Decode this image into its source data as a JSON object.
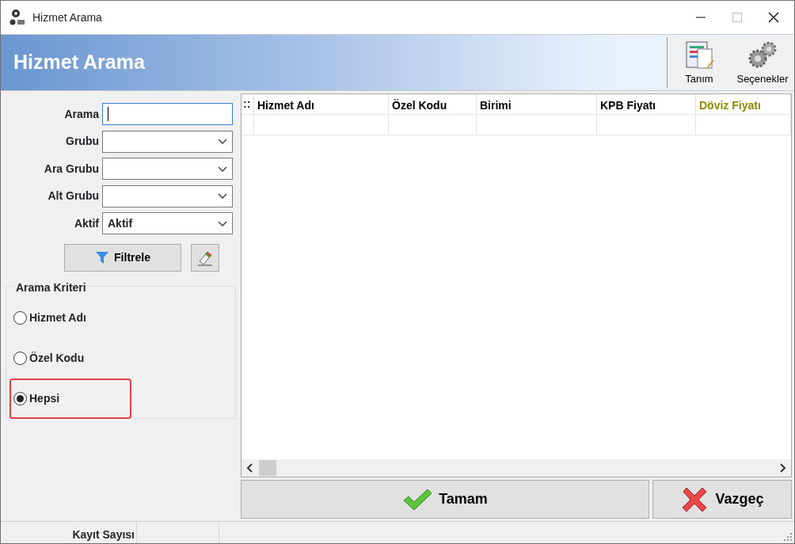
{
  "window": {
    "title": "Hizmet Arama"
  },
  "header": {
    "title": "Hizmet Arama",
    "tools": [
      {
        "label": "Tanım",
        "kind": "document"
      },
      {
        "label": "Seçenekler",
        "kind": "gears"
      }
    ]
  },
  "filters": [
    {
      "label": "Arama",
      "kind": "text",
      "focused": true
    },
    {
      "label": "Grubu",
      "kind": "select"
    },
    {
      "label": "Ara Grubu",
      "kind": "select"
    },
    {
      "label": "Alt Grubu",
      "kind": "select"
    },
    {
      "label": "Aktif",
      "kind": "select",
      "value": "Aktif"
    }
  ],
  "filter_button": "Filtrele",
  "criteria": {
    "title": "Arama Kriteri",
    "options": [
      {
        "label": "Hizmet Adı",
        "selected": false,
        "highlighted": false
      },
      {
        "label": "Özel Kodu",
        "selected": false,
        "highlighted": false
      },
      {
        "label": "Hepsi",
        "selected": true,
        "highlighted": true
      }
    ]
  },
  "table": {
    "handle": "::",
    "columns": [
      {
        "label": "Hizmet Adı",
        "color": "#000000"
      },
      {
        "label": "Özel Kodu",
        "color": "#000000"
      },
      {
        "label": "Birimi",
        "color": "#000000"
      },
      {
        "label": "KPB Fiyatı",
        "color": "#000000"
      },
      {
        "label": "Döviz Fiyatı",
        "color": "#8c8a00"
      }
    ]
  },
  "buttons": [
    {
      "label": "Tamam",
      "kind": "ok"
    },
    {
      "label": "Vazgeç",
      "kind": "cancel"
    }
  ],
  "status_bar": {
    "label": "Kayıt Sayısı"
  }
}
